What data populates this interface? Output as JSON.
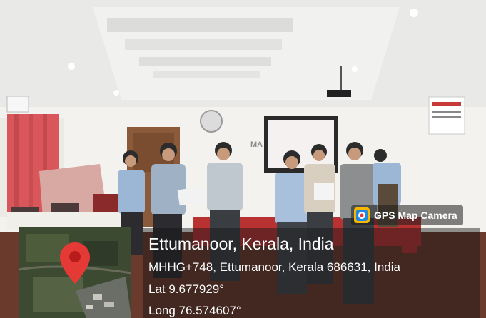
{
  "overlay": {
    "app_name": "GPS Map Camera",
    "place": "Ettumanoor, Kerala, India",
    "address": "MHHG+748, Ettumanoor, Kerala 686631, India",
    "latitude": "Lat 9.677929°",
    "longitude": "Long 76.574607°"
  },
  "scene": {
    "wall_text": "MA"
  },
  "colors": {
    "pin": "#e53935",
    "panel_bg": "#141414",
    "text": "#ffffff"
  },
  "icons": {
    "app_logo": "gps-map-camera-logo-icon",
    "pin": "location-pin-icon"
  }
}
